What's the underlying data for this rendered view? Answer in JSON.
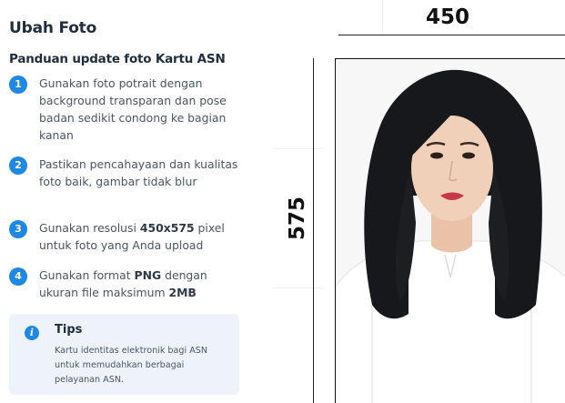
{
  "page": {
    "title": "Ubah Foto"
  },
  "guide": {
    "title": "Panduan update foto Kartu ASN",
    "steps": [
      {
        "number": "1",
        "parts": [
          "Gunakan foto potrait dengan background transparan dan pose badan sedikit condong ke bagian kanan"
        ]
      },
      {
        "number": "2",
        "parts": [
          "Pastikan pencahayaan dan kualitas foto baik, gambar tidak blur"
        ]
      },
      {
        "number": "3",
        "parts": [
          "Gunakan resolusi ",
          "450x575",
          " pixel untuk foto yang Anda upload"
        ]
      },
      {
        "number": "4",
        "parts": [
          "Gunakan format ",
          "PNG",
          " dengan ukuran file maksimum ",
          "2MB"
        ]
      }
    ]
  },
  "tips": {
    "title": "Tips",
    "body": "Kartu identitas elektronik bagi ASN untuk memudahkan berbagai pelayanan ASN."
  },
  "photo": {
    "width_label": "450",
    "height_label": "575",
    "description_icon": "portrait-photo"
  },
  "colors": {
    "accent": "#1e88e5",
    "tips_background": "#edf2fb",
    "heading": "#1f2d3d"
  }
}
